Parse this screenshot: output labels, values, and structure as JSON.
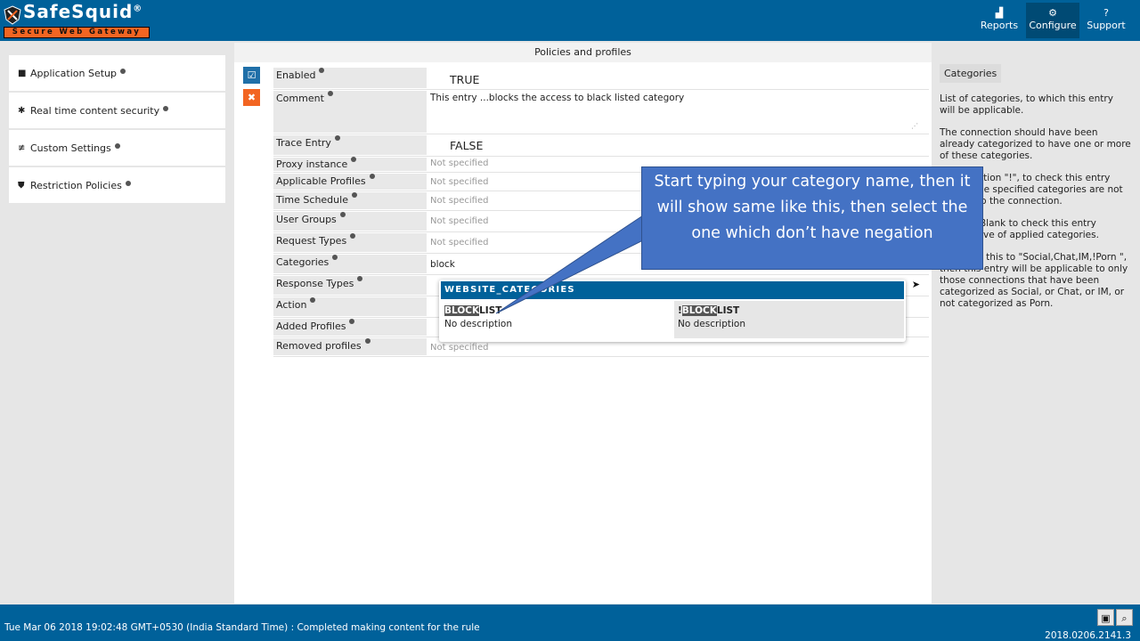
{
  "header": {
    "logo_title": "SafeSquid",
    "logo_reg": "®",
    "logo_subtitle": "Secure Web Gateway",
    "nav": [
      {
        "label": "Reports",
        "icon": "chart-area-icon",
        "glyph": "▟",
        "active": false
      },
      {
        "label": "Configure",
        "icon": "cogs-icon",
        "glyph": "⚙",
        "active": true
      },
      {
        "label": "Support",
        "icon": "question-circle-icon",
        "glyph": "?",
        "active": false
      }
    ]
  },
  "sidebar": {
    "items": [
      {
        "label": "Application Setup",
        "icon": "briefcase-icon",
        "glyph": "■"
      },
      {
        "label": "Real time content security",
        "icon": "bug-icon",
        "glyph": "✱"
      },
      {
        "label": "Custom Settings",
        "icon": "sliders-icon",
        "glyph": "≢"
      },
      {
        "label": "Restriction Policies",
        "icon": "shield-icon",
        "glyph": "⛊"
      }
    ]
  },
  "main": {
    "title": "Policies and profiles",
    "enable_glyph": "☑",
    "delete_glyph": "✖",
    "fields": [
      {
        "label": "Enabled",
        "value": "TRUE"
      },
      {
        "label": "Comment",
        "value": "This entry ...blocks the access to black listed category"
      },
      {
        "label": "Trace Entry",
        "value": "FALSE"
      },
      {
        "label": "Proxy instance",
        "value": "Not specified"
      },
      {
        "label": "Applicable Profiles",
        "value": "Not specified"
      },
      {
        "label": "Time Schedule",
        "value": "Not specified"
      },
      {
        "label": "User Groups",
        "value": "Not specified"
      },
      {
        "label": "Request Types",
        "value": "Not specified"
      },
      {
        "label": "Categories",
        "value": "block"
      },
      {
        "label": "Response Types",
        "value": ""
      },
      {
        "label": "Action",
        "value": ""
      },
      {
        "label": "Added Profiles",
        "value": ""
      },
      {
        "label": "Removed profiles",
        "value": "Not specified"
      }
    ],
    "dropdown": {
      "header": "WEBSITE_CATEGORIES",
      "options": [
        {
          "prefix": "",
          "match": "BLOCK",
          "rest": "LIST",
          "description": "No description"
        },
        {
          "prefix": "!",
          "match": "BLOCK",
          "rest": "LIST",
          "description": "No description"
        }
      ]
    }
  },
  "help": {
    "title": "Categories",
    "paragraphs": [
      "List of categories, to which this entry will be applicable.",
      "The connection should have been already categorized to have one or more of these categories.",
      "Use negation \"!\", to check this entry only, if the specified categories are not applied to the connection.",
      "Leave it Blank to check this entry irrespective of applied categories.",
      "If you set this to \"Social,Chat,IM,!Porn \", then this entry will be applicable to only those connections that have been categorized as Social, or Chat, or IM, or not categorized as Porn."
    ]
  },
  "callout": {
    "text": "Start typing your category name, then it will show same like this, then select the one which don’t have negation",
    "color": "#4472c4"
  },
  "footer": {
    "status": "Tue Mar 06 2018 19:02:48 GMT+0530 (India Standard Time) : Completed making content for the rule",
    "version": "2018.0206.2141.3",
    "save_glyph": "💾",
    "search_glyph": "🔍"
  },
  "colors": {
    "brand_blue": "#00619a",
    "accent_orange": "#f26522",
    "active_nav": "#004a74"
  }
}
